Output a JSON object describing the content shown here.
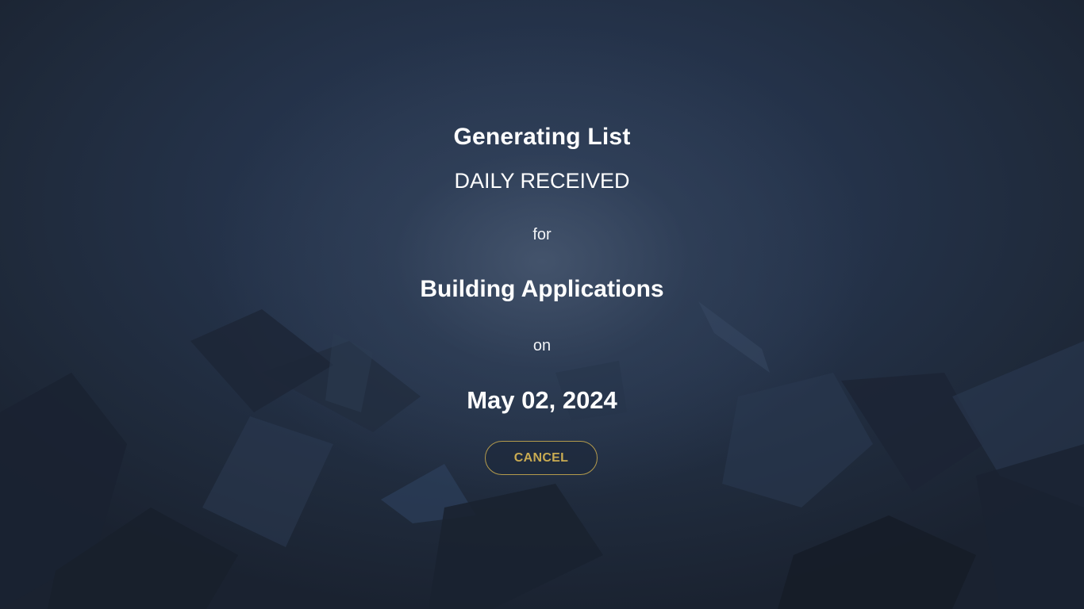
{
  "dialog": {
    "title": "Generating List",
    "list_name": "DAILY RECEIVED",
    "for_label": "for",
    "category": "Building Applications",
    "on_label": "on",
    "date": "May 02, 2024",
    "cancel_label": "CANCEL"
  },
  "colors": {
    "background": "#1e2633",
    "text": "#ffffff",
    "accent": "#c9ab52"
  }
}
